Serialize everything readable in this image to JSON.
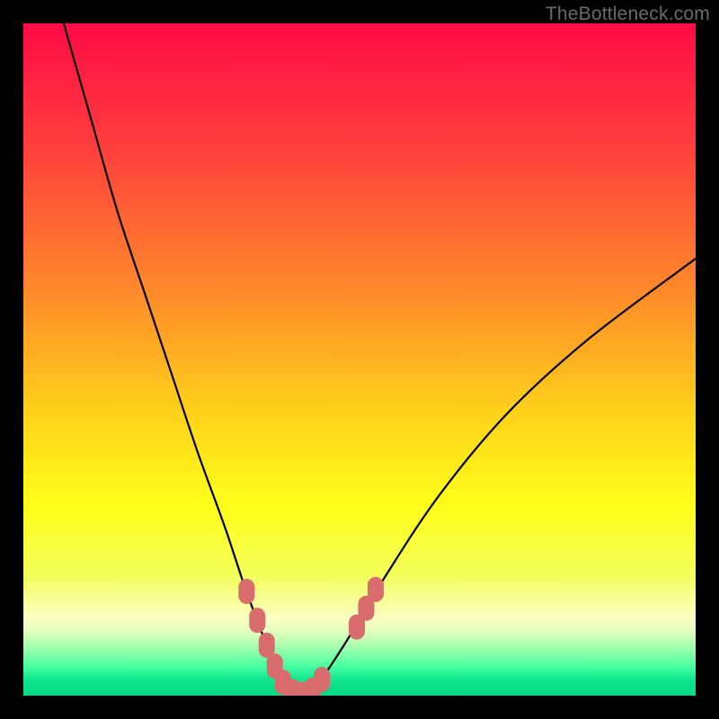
{
  "watermark": "TheBottleneck.com",
  "chart_data": {
    "type": "line",
    "title": "",
    "xlabel": "",
    "ylabel": "",
    "xlim": [
      0,
      100
    ],
    "ylim": [
      0,
      100
    ],
    "grid": false,
    "series": [
      {
        "name": "bottleneck-curve",
        "x": [
          6,
          10,
          14,
          18,
          22,
          26,
          30,
          33,
          36,
          38,
          39.5,
          41,
          42.5,
          44,
          48,
          54,
          62,
          72,
          84,
          100
        ],
        "y": [
          100,
          86,
          72,
          60,
          48,
          36,
          25,
          16,
          8,
          3,
          1,
          0,
          0.5,
          2,
          8,
          18,
          30,
          42,
          53,
          65
        ]
      }
    ],
    "highlight_points": {
      "name": "highlight-band",
      "color": "#d96c6c",
      "points": [
        {
          "x": 33.2,
          "y": 15.5
        },
        {
          "x": 34.8,
          "y": 11.2
        },
        {
          "x": 36.2,
          "y": 7.5
        },
        {
          "x": 37.4,
          "y": 4.4
        },
        {
          "x": 38.6,
          "y": 2.0
        },
        {
          "x": 40.0,
          "y": 0.6
        },
        {
          "x": 41.4,
          "y": 0.2
        },
        {
          "x": 43.0,
          "y": 0.8
        },
        {
          "x": 44.4,
          "y": 2.4
        },
        {
          "x": 49.6,
          "y": 10.2
        },
        {
          "x": 51.0,
          "y": 13.0
        },
        {
          "x": 52.4,
          "y": 15.8
        }
      ]
    },
    "gradient_stops": [
      {
        "offset": 0.0,
        "color": "#ff0b46"
      },
      {
        "offset": 0.18,
        "color": "#ff3d3d"
      },
      {
        "offset": 0.4,
        "color": "#ff8a2a"
      },
      {
        "offset": 0.58,
        "color": "#ffd21a"
      },
      {
        "offset": 0.72,
        "color": "#ffff1a"
      },
      {
        "offset": 0.82,
        "color": "#f3ff5a"
      },
      {
        "offset": 0.885,
        "color": "#fdffc3"
      },
      {
        "offset": 0.905,
        "color": "#e2ffbd"
      },
      {
        "offset": 0.93,
        "color": "#9cffad"
      },
      {
        "offset": 0.955,
        "color": "#4effa0"
      },
      {
        "offset": 0.975,
        "color": "#12e88f"
      },
      {
        "offset": 1.0,
        "color": "#02d884"
      }
    ]
  }
}
